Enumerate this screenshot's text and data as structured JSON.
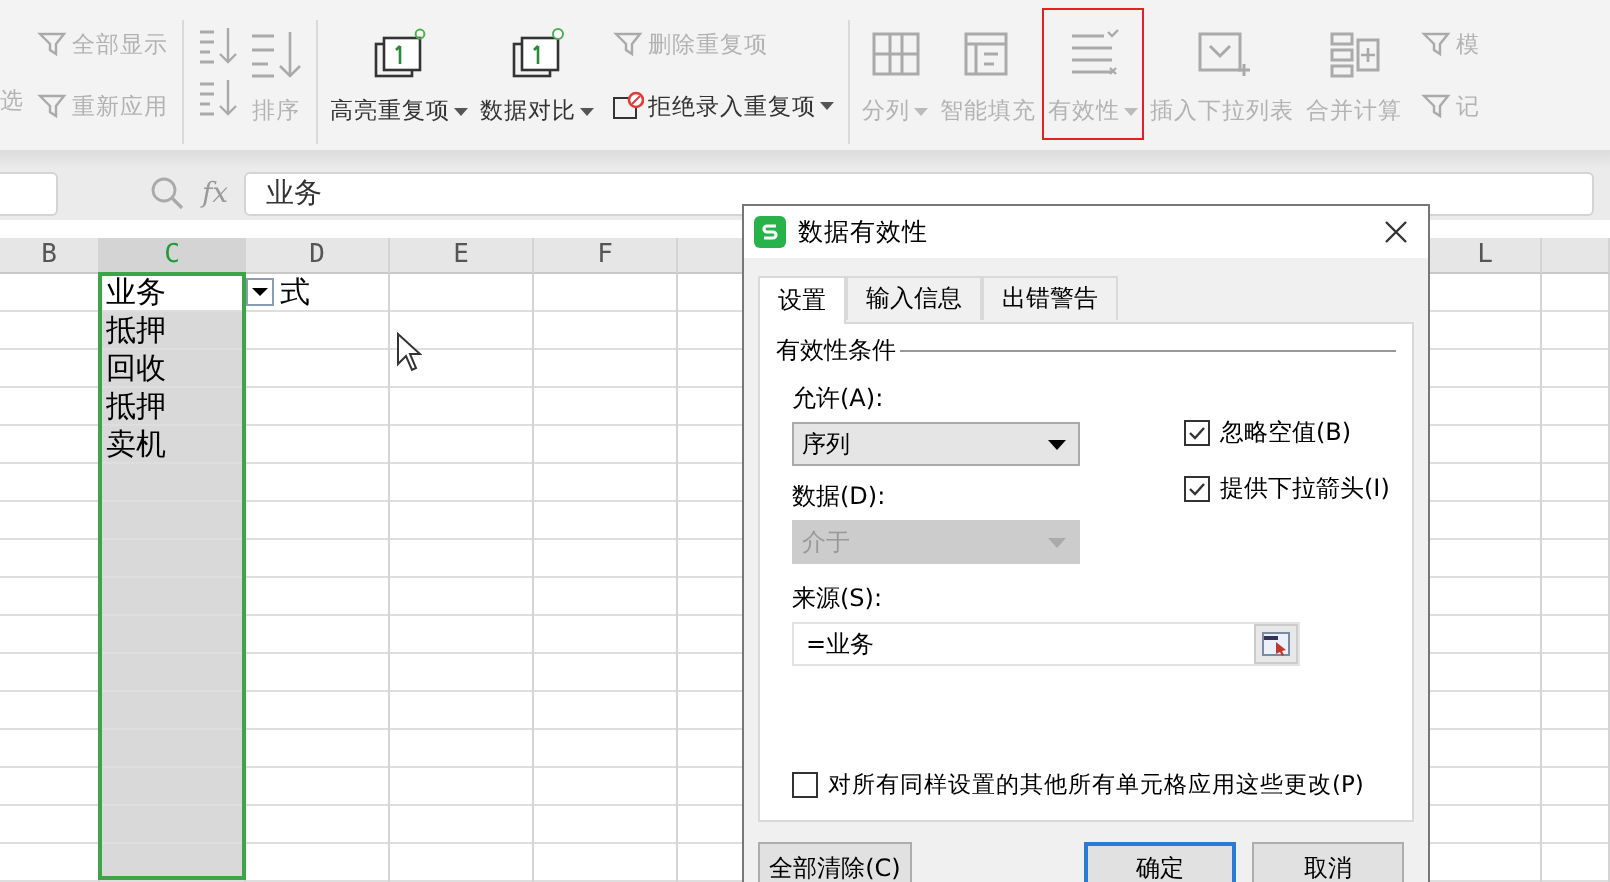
{
  "toolbar": {
    "items": [
      {
        "kind": "big",
        "label": "选",
        "disabled": true,
        "dropdown": false,
        "highlighted": false
      },
      {
        "kind": "stack",
        "entries": [
          {
            "label": "全部显示",
            "disabled": true,
            "dropdown": false
          },
          {
            "label": "重新应用",
            "disabled": true,
            "dropdown": false
          }
        ]
      },
      {
        "kind": "separator"
      },
      {
        "kind": "sort",
        "label": "排序",
        "disabled": true
      },
      {
        "kind": "separator"
      },
      {
        "kind": "big",
        "label": "高亮重复项",
        "disabled": false,
        "dropdown": true,
        "highlighted": false
      },
      {
        "kind": "big",
        "label": "数据对比",
        "disabled": false,
        "dropdown": true,
        "highlighted": false
      },
      {
        "kind": "stack",
        "entries": [
          {
            "label": "删除重复项",
            "disabled": true,
            "dropdown": false
          },
          {
            "label": "拒绝录入重复项",
            "disabled": false,
            "dropdown": true
          }
        ]
      },
      {
        "kind": "separator"
      },
      {
        "kind": "big",
        "label": "分列",
        "disabled": true,
        "dropdown": true,
        "highlighted": false
      },
      {
        "kind": "big",
        "label": "智能填充",
        "disabled": true,
        "dropdown": false,
        "highlighted": false
      },
      {
        "kind": "big",
        "label": "有效性",
        "disabled": true,
        "dropdown": true,
        "highlighted": true
      },
      {
        "kind": "big",
        "label": "插入下拉列表",
        "disabled": true,
        "dropdown": false,
        "highlighted": false
      },
      {
        "kind": "big",
        "label": "合并计算",
        "disabled": true,
        "dropdown": false,
        "highlighted": false
      },
      {
        "kind": "stack",
        "entries": [
          {
            "label": "模",
            "disabled": true,
            "dropdown": false
          },
          {
            "label": "记",
            "disabled": true,
            "dropdown": false
          }
        ]
      }
    ]
  },
  "formula_bar": {
    "fx": "fx",
    "value": "业务"
  },
  "sheet": {
    "columns": [
      {
        "label": "B",
        "selected": false
      },
      {
        "label": "C",
        "selected": true
      },
      {
        "label": "D",
        "selected": false
      },
      {
        "label": "E",
        "selected": false
      },
      {
        "label": "F",
        "selected": false
      },
      {
        "label": "L",
        "selected": false
      }
    ],
    "rows": [
      {
        "C": "业务",
        "D": "式",
        "dropdown": true
      },
      {
        "C": "抵押",
        "dropdown": false
      },
      {
        "C": "回收",
        "dropdown": false
      },
      {
        "C": "抵押",
        "dropdown": false
      },
      {
        "C": "卖机",
        "dropdown": false
      }
    ]
  },
  "dialog": {
    "title": "数据有效性",
    "tabs": [
      {
        "label": "设置",
        "selected": true
      },
      {
        "label": "输入信息",
        "selected": false
      },
      {
        "label": "出错警告",
        "selected": false
      }
    ],
    "group_title": "有效性条件",
    "allow": {
      "label": "允许(A):",
      "value": "序列",
      "disabled": false
    },
    "data": {
      "label": "数据(D):",
      "value": "介于",
      "disabled": true
    },
    "checkboxes": [
      {
        "label": "忽略空值(B)",
        "checked": true
      },
      {
        "label": "提供下拉箭头(I)",
        "checked": true
      }
    ],
    "source": {
      "label": "来源(S):",
      "value": "=业务"
    },
    "apply_all": {
      "label": "对所有同样设置的其他所有单元格应用这些更改(P)",
      "checked": false
    },
    "buttons": [
      {
        "label": "全部清除(C)",
        "kind": "secondary"
      },
      {
        "label": "确定",
        "kind": "default"
      },
      {
        "label": "取消",
        "kind": "normal"
      }
    ]
  }
}
